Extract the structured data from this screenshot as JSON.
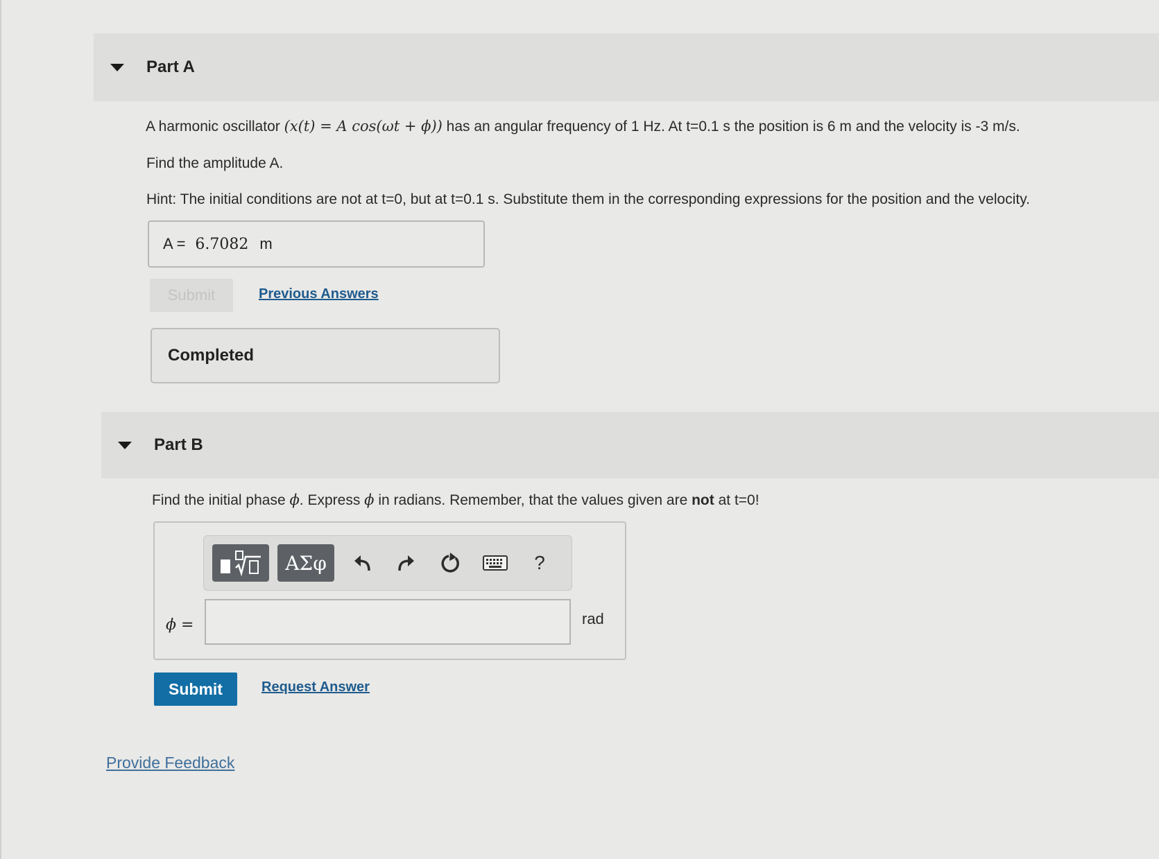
{
  "part_a": {
    "title": "Part A",
    "problem_prefix": "A harmonic oscillator",
    "formula": "(x(t) = A cos(ωt + ϕ))",
    "problem_suffix": "has an angular frequency of 1 Hz. At t=0.1 s the position is 6 m and the velocity is -3 m/s.",
    "question": "Find the amplitude A.",
    "hint": "Hint: The initial conditions are not at t=0, but at t=0.1 s. Substitute them in the corresponding expressions for the position and the velocity.",
    "answer_label": "A =",
    "answer_value": "6.7082",
    "answer_unit": "m",
    "submit_label": "Submit",
    "previous_answers_label": "Previous Answers",
    "status": "Completed"
  },
  "part_b": {
    "title": "Part B",
    "q_prefix": "Find the initial phase",
    "q_symbol": "ϕ",
    "q_mid": ". Express",
    "q_mid2": "in radians. Remember, that the values given are",
    "q_bold": "not",
    "q_end": "at t=0!",
    "toolbar": {
      "templates_icon": "template-sqrt-icon",
      "greek_label": "ΑΣφ",
      "undo_icon": "undo-icon",
      "redo_icon": "redo-icon",
      "reset_icon": "reset-icon",
      "keyboard_icon": "keyboard-icon",
      "help_label": "?"
    },
    "input_label": "ϕ =",
    "input_value": "",
    "unit": "rad",
    "submit_label": "Submit",
    "request_answer_label": "Request Answer"
  },
  "feedback_label": "Provide Feedback",
  "colors": {
    "background": "#e9e9e7",
    "submit_blue": "#126ea5",
    "link_blue": "#1f5b8e",
    "toolbar_button": "#5d6166"
  }
}
